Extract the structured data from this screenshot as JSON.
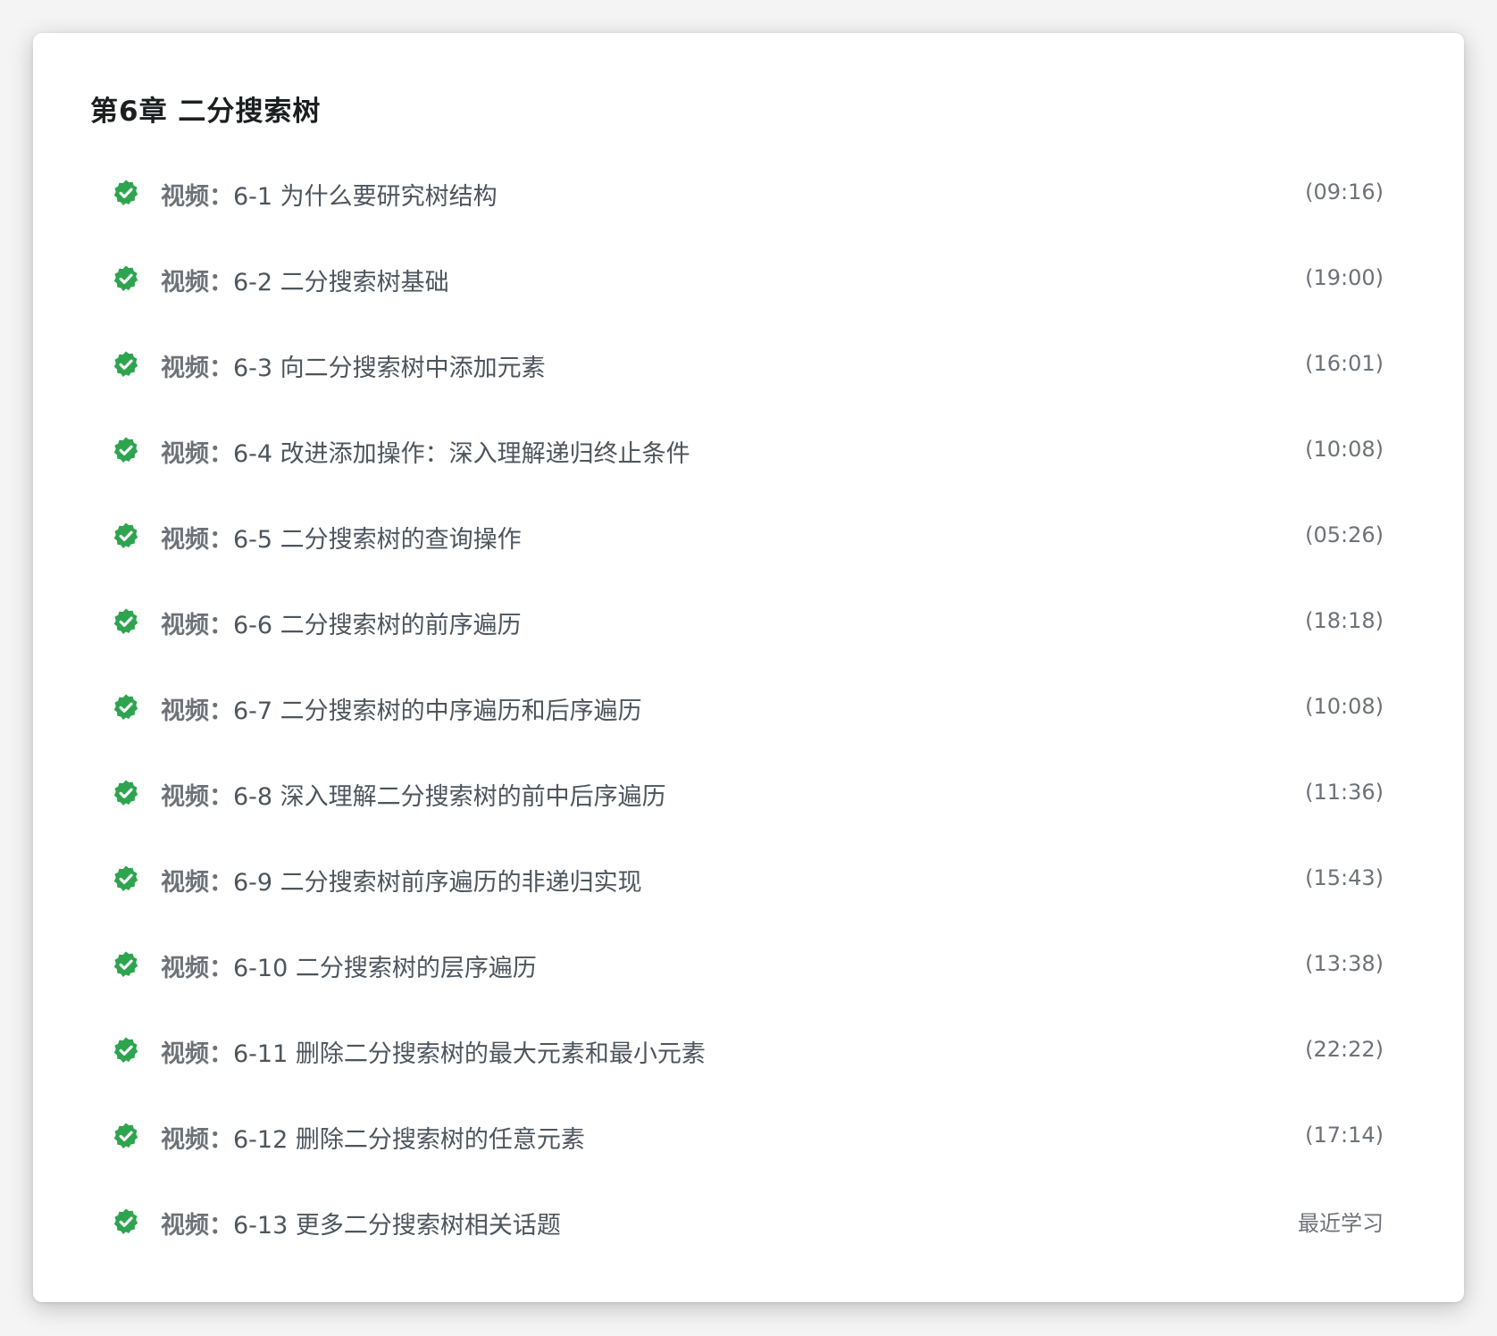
{
  "chapter": {
    "title": "第6章 二分搜索树"
  },
  "colors": {
    "check_green": "#2ea44f",
    "title_text": "#1c1f21",
    "lesson_text": "#4d555d",
    "meta_text": "#6d7278"
  },
  "lessons": [
    {
      "type": "视频：",
      "title": "6-1 为什么要研究树结构",
      "duration": "(09:16)",
      "status_icon": "check-circle-icon"
    },
    {
      "type": "视频：",
      "title": "6-2 二分搜索树基础",
      "duration": "(19:00)",
      "status_icon": "check-circle-icon"
    },
    {
      "type": "视频：",
      "title": "6-3 向二分搜索树中添加元素",
      "duration": "(16:01)",
      "status_icon": "check-circle-icon"
    },
    {
      "type": "视频：",
      "title": "6-4 改进添加操作：深入理解递归终止条件",
      "duration": "(10:08)",
      "status_icon": "check-circle-icon"
    },
    {
      "type": "视频：",
      "title": "6-5 二分搜索树的查询操作",
      "duration": "(05:26)",
      "status_icon": "check-circle-icon"
    },
    {
      "type": "视频：",
      "title": "6-6 二分搜索树的前序遍历",
      "duration": "(18:18)",
      "status_icon": "check-circle-icon"
    },
    {
      "type": "视频：",
      "title": "6-7 二分搜索树的中序遍历和后序遍历",
      "duration": "(10:08)",
      "status_icon": "check-circle-icon"
    },
    {
      "type": "视频：",
      "title": "6-8 深入理解二分搜索树的前中后序遍历",
      "duration": "(11:36)",
      "status_icon": "check-circle-icon"
    },
    {
      "type": "视频：",
      "title": "6-9 二分搜索树前序遍历的非递归实现",
      "duration": "(15:43)",
      "status_icon": "check-circle-icon"
    },
    {
      "type": "视频：",
      "title": "6-10 二分搜索树的层序遍历",
      "duration": "(13:38)",
      "status_icon": "check-circle-icon"
    },
    {
      "type": "视频：",
      "title": "6-11 删除二分搜索树的最大元素和最小元素",
      "duration": "(22:22)",
      "status_icon": "check-circle-icon"
    },
    {
      "type": "视频：",
      "title": "6-12 删除二分搜索树的任意元素",
      "duration": "(17:14)",
      "status_icon": "check-circle-icon"
    },
    {
      "type": "视频：",
      "title": "6-13 更多二分搜索树相关话题",
      "duration": "最近学习",
      "status_icon": "check-circle-icon"
    }
  ]
}
